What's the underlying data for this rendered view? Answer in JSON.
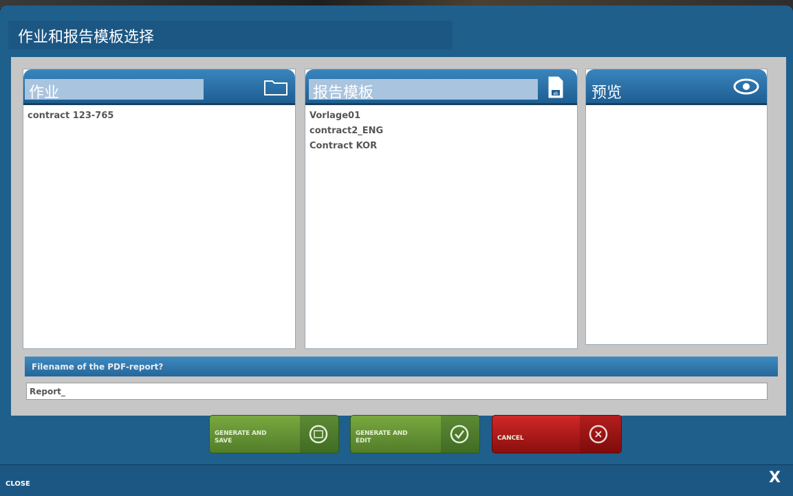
{
  "window": {
    "title": "作业和报告模板选择"
  },
  "panels": {
    "jobs": {
      "header": "作业",
      "icon": "folder-icon",
      "items": [
        "contract 123-765"
      ]
    },
    "templates": {
      "header": "报告模板",
      "icon": "document-icon",
      "items": [
        "Vorlage01",
        "contract2_ENG",
        "Contract KOR"
      ]
    },
    "preview": {
      "header": "预览",
      "icon": "eye-icon"
    }
  },
  "filename": {
    "label": "Filename of the PDF-report?",
    "value": "Report_"
  },
  "buttons": {
    "generate_save": "GENERATE AND\nSAVE",
    "generate_edit": "GENERATE AND\nEDIT",
    "cancel": "CANCEL"
  },
  "footer": {
    "close_label": "CLOSE",
    "close_x": "X"
  },
  "colors": {
    "frame": "#1f5f8c",
    "header_blue": "#2f78b0",
    "button_green": "#6a9a36",
    "button_red": "#c01f1f"
  }
}
